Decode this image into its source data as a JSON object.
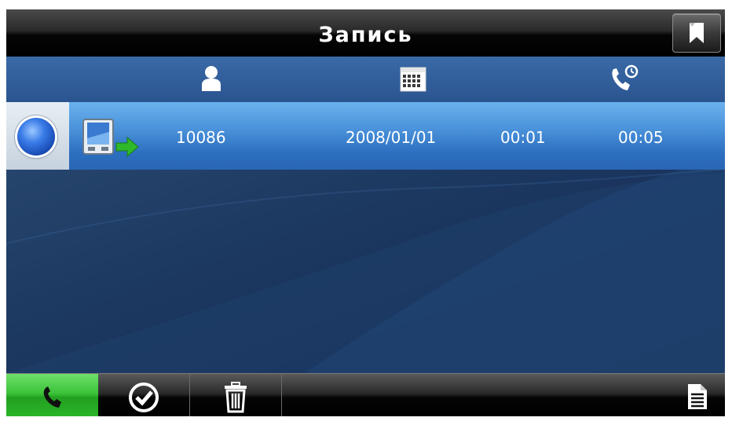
{
  "title": "Запись",
  "columns": {
    "contact_icon": "person-icon",
    "date_icon": "calendar-icon",
    "duration_icon": "call-duration-icon"
  },
  "records": [
    {
      "number": "10086",
      "date": "2008/01/01",
      "time": "00:01",
      "duration": "00:05",
      "direction": "outgoing",
      "selected": true
    }
  ],
  "toolbar": {
    "buttons": [
      "phone-icon",
      "checkmark-icon",
      "trash-icon",
      "document-icon"
    ],
    "active": "phone-icon"
  },
  "colors": {
    "accent_green": "#3cc23a",
    "row_highlight": "#4a92da",
    "header_blue": "#2f5e9c",
    "background": "#17305a"
  }
}
